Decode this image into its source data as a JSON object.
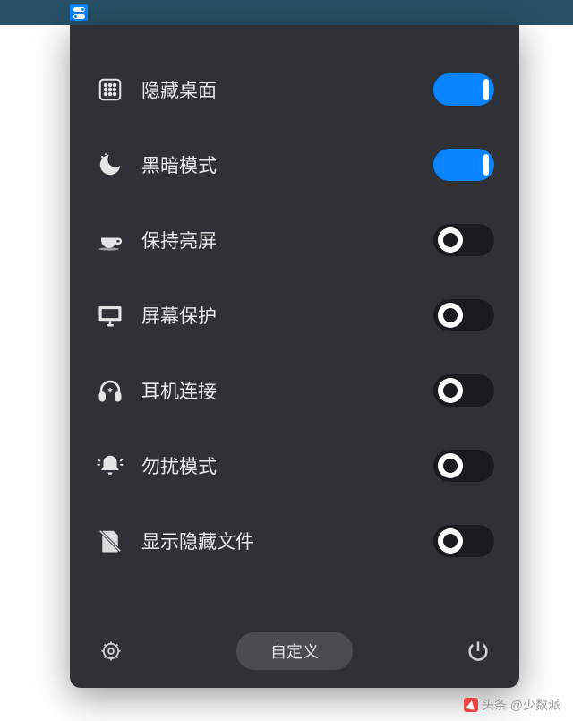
{
  "items": [
    {
      "icon": "desktop-grid-icon",
      "label": "隐藏桌面",
      "state": "on"
    },
    {
      "icon": "dark-mode-icon",
      "label": "黑暗模式",
      "state": "on"
    },
    {
      "icon": "coffee-icon",
      "label": "保持亮屏",
      "state": "off"
    },
    {
      "icon": "monitor-icon",
      "label": "屏幕保护",
      "state": "off"
    },
    {
      "icon": "headphones-icon",
      "label": "耳机连接",
      "state": "off"
    },
    {
      "icon": "bell-icon",
      "label": "勿扰模式",
      "state": "off"
    },
    {
      "icon": "hidden-file-icon",
      "label": "显示隐藏文件",
      "state": "off"
    }
  ],
  "footer": {
    "settings_icon": "gear-icon",
    "custom_label": "自定义",
    "power_icon": "power-icon"
  },
  "watermark": "头条 @少数派"
}
